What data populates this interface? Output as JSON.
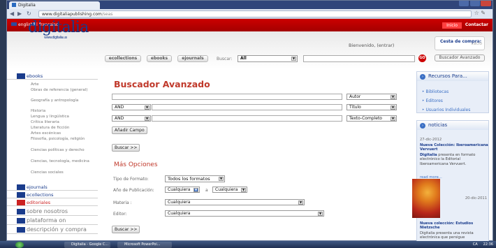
{
  "browser": {
    "tab_title": "Digitalia",
    "url_host": "www.digitaliapublishing.com",
    "url_path": "/seas"
  },
  "topbar": {
    "lang_en": "english",
    "lang_fr": "francaise",
    "inicio": "Inicio",
    "contactar": "Contactar"
  },
  "header": {
    "logo": "digitalia",
    "logo_url": "www.digitalia.us",
    "welcome": "Bienvenido, (entrar)",
    "cart_label": "Cesta de compra:",
    "cart_status": "vacío",
    "nav": [
      "ecollections",
      "ebooks",
      "ejournals"
    ],
    "buscar_label": "Buscar:",
    "buscar_scope": "All",
    "go_label": "GO",
    "advanced_btn": "Buscador Avanzado"
  },
  "sidebar": {
    "ebooks_label": "ebooks",
    "categories": [
      "Arte",
      "Obras de referencia (general)",
      "Geografía y antropología",
      "Historia",
      "Lengua y lingüística",
      "Crítica literaria",
      "Literatura de ficción",
      "Artes escénicas",
      "Filosofía, psicología, religión",
      "Ciencias políticas y derecho",
      "Ciencias, tecnología, medicina",
      "Ciencias sociales"
    ],
    "ejournals_label": "ejournals",
    "ecollections_label": "ecollections",
    "editoriales_label": "editoriales",
    "sobre": "sobre nosotros",
    "plataforma": "plataforma on",
    "descripcion": "descripción y compra"
  },
  "main": {
    "title": "Buscador Avanzado",
    "field1_type": "Autor",
    "op2": "AND",
    "field2_type": "Título",
    "op3": "AND",
    "field3_type": "Texto-Completo",
    "add_field_btn": "Añadir Campo",
    "search_btn": "Buscar >>",
    "more_options_title": "Más Opciones",
    "format_label": "Tipo de Formato:",
    "format_value": "Todos los formatos",
    "year_label": "Año de Publicación:",
    "year_from": "Cualquiera",
    "year_sep": "a",
    "year_to": "Cualquiera",
    "materia_label": "Materia :",
    "materia_value": "Cualquiera",
    "editor_label": "Editor:",
    "editor_value": "Cualquiera",
    "search_btn2": "Buscar >>"
  },
  "right": {
    "recursos_title": "Recursos Para...",
    "recursos_items": [
      "Bibliotecas",
      "Editores",
      "Usuarios Individuales"
    ],
    "noticias_title": "noticias",
    "news1_date": "27-dic-2012",
    "news1_head": "Nueva Colección: Iberoamericana Vervuert",
    "news1_body_bold": "Digitalia",
    "news1_body": "presenta en formato electrónico la Editorial Iberoamericana Vervuert.",
    "read_more": "read more...",
    "news2_date": "20-dic-2011",
    "news2_head": "Nueva colección: Estudios Nietzsche",
    "news2_body": "Digitalia presenta una revista electrónica que persigue"
  },
  "taskbar": {
    "item1": "Digitalia - Google C...",
    "item2": "Microsoft PowerPoi...",
    "lang": "CA",
    "clock": "22:36"
  }
}
